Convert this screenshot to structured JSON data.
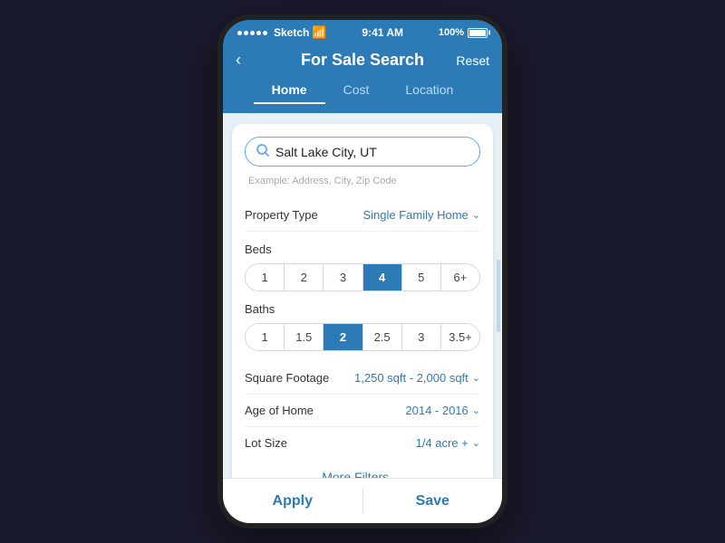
{
  "statusBar": {
    "carrier": "Sketch",
    "time": "9:41 AM",
    "battery": "100%",
    "wifi": true
  },
  "navBar": {
    "backLabel": "‹",
    "title": "For Sale Search",
    "resetLabel": "Reset"
  },
  "tabs": [
    {
      "id": "home",
      "label": "Home",
      "active": true
    },
    {
      "id": "cost",
      "label": "Cost",
      "active": false
    },
    {
      "id": "location",
      "label": "Location",
      "active": false
    }
  ],
  "search": {
    "value": "Salt Lake City, UT",
    "placeholder": "Example: Address, City, Zip Code"
  },
  "propertyType": {
    "label": "Property Type",
    "value": "Single Family Home"
  },
  "beds": {
    "label": "Beds",
    "options": [
      "1",
      "2",
      "3",
      "4",
      "5",
      "6+"
    ],
    "selected": "4"
  },
  "baths": {
    "label": "Baths",
    "options": [
      "1",
      "1.5",
      "2",
      "2.5",
      "3",
      "3.5+"
    ],
    "selected": "2"
  },
  "squareFootage": {
    "label": "Square Footage",
    "value": "1,250 sqft - 2,000 sqft"
  },
  "ageOfHome": {
    "label": "Age of Home",
    "value": "2014 - 2016"
  },
  "lotSize": {
    "label": "Lot Size",
    "value": "1/4 acre +"
  },
  "moreFilters": {
    "label": "More Filters"
  },
  "bottomBar": {
    "applyLabel": "Apply",
    "saveLabel": "Save"
  },
  "colors": {
    "accent": "#2c7bb6",
    "selected": "#4a9de0"
  }
}
